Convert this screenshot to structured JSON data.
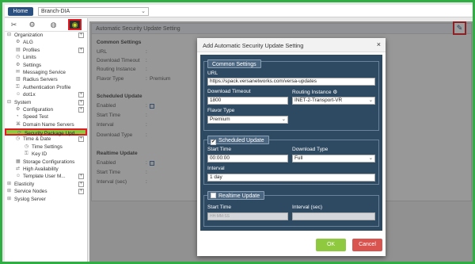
{
  "topbar": {
    "home_label": "Home",
    "branch_value": "Branch-DIA"
  },
  "toolbar": {
    "icons": [
      "tools-icon",
      "gear-icon",
      "globe-icon",
      "appliance-icon"
    ]
  },
  "sidebar": {
    "items": [
      {
        "label": "Organization",
        "level": 0,
        "icon": "minus-square-icon",
        "has_add": true
      },
      {
        "label": "ALG",
        "level": 1,
        "icon": "settings-icon"
      },
      {
        "label": "Profiles",
        "level": 1,
        "icon": "profile-icon",
        "has_add": true
      },
      {
        "label": "Limits",
        "level": 1,
        "icon": "clock-icon"
      },
      {
        "label": "Settings",
        "level": 1,
        "icon": "settings-icon"
      },
      {
        "label": "Messaging Service",
        "level": 1,
        "icon": "message-icon"
      },
      {
        "label": "Radius Servers",
        "level": 1,
        "icon": "server-icon"
      },
      {
        "label": "Authentication Profile",
        "level": 1,
        "icon": "key-icon"
      },
      {
        "label": "dot1x",
        "level": 1,
        "icon": "user-icon",
        "has_add": true
      },
      {
        "label": "System",
        "level": 0,
        "icon": "minus-square-icon",
        "has_add": true
      },
      {
        "label": "Configuration",
        "level": 1,
        "icon": "config-icon",
        "has_add": true
      },
      {
        "label": "Speed Test",
        "level": 1,
        "icon": "gauge-icon"
      },
      {
        "label": "Domain Name Servers",
        "level": 1,
        "icon": "dns-icon"
      },
      {
        "label": "Security Package Upd...",
        "level": 1,
        "icon": "update-icon",
        "selected": true
      },
      {
        "label": "Time & Date",
        "level": 1,
        "icon": "clock-icon",
        "has_add": true
      },
      {
        "label": "Time Settings",
        "level": 2,
        "icon": "time-icon"
      },
      {
        "label": "Key ID",
        "level": 2,
        "icon": "key-icon"
      },
      {
        "label": "Storage Configurations",
        "level": 1,
        "icon": "storage-icon"
      },
      {
        "label": "High Availability",
        "level": 1,
        "icon": "ha-icon"
      },
      {
        "label": "Template User M...",
        "level": 1,
        "icon": "user-icon",
        "has_add": true
      },
      {
        "label": "Elasticity",
        "level": 0,
        "icon": "plus-square-icon",
        "has_add": true
      },
      {
        "label": "Service Nodes",
        "level": 0,
        "icon": "plus-square-icon",
        "has_add": true
      },
      {
        "label": "Syslog Server",
        "level": 0,
        "icon": "plus-square-icon"
      }
    ]
  },
  "panel": {
    "title": "Automatic Security Update Setting",
    "common_heading": "Common Settings",
    "common_rows": [
      "URL",
      "Download Timeout",
      "Routing Instance",
      "Flavor Type"
    ],
    "flavor_value": "Premium",
    "scheduled_heading": "Scheduled Update",
    "scheduled_rows": [
      "Enabled",
      "Start Time",
      "Interval",
      "Download Type"
    ],
    "realtime_heading": "Realtime Update",
    "realtime_rows": [
      "Enabled",
      "Start Time",
      "Interval (sec)"
    ],
    "colon": ":"
  },
  "modal": {
    "title": "Add Automatic Security Update Setting",
    "close_glyph": "×",
    "common": {
      "tag": "Common Settings",
      "url_label": "URL",
      "url_value": "https://spack.versanetworks.com/versa-updates",
      "timeout_label": "Download Timeout",
      "timeout_value": "1800",
      "routing_label": "Routing Instance",
      "routing_value": "INET-2-Transport-VR",
      "flavor_label": "Flavor Type",
      "flavor_value": "Premium"
    },
    "scheduled": {
      "tag": "Scheduled Update",
      "start_label": "Start Time",
      "start_value": "00:00:00",
      "dltype_label": "Download Type",
      "dltype_value": "Full",
      "interval_label": "Interval",
      "interval_value": "1 day"
    },
    "realtime": {
      "tag": "Realtime Update",
      "start_label": "Start Time",
      "start_placeholder": "HH:MM:SS",
      "interval_label": "Interval (sec)"
    },
    "ok_label": "OK",
    "cancel_label": "Cancel"
  }
}
